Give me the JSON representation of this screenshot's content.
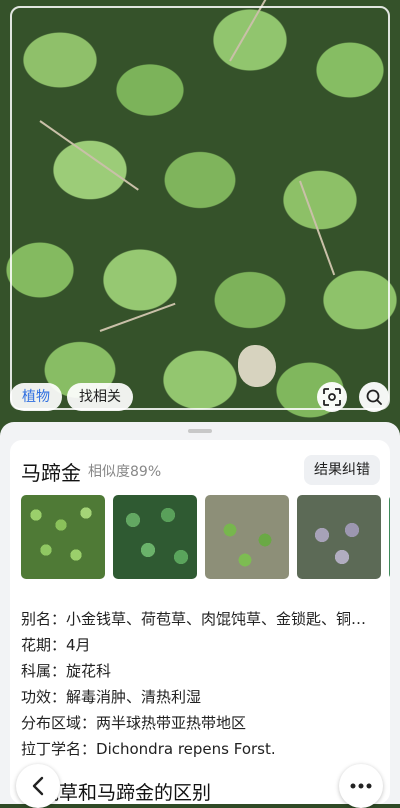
{
  "photo": {
    "chips": [
      {
        "label": "植物",
        "active": true
      },
      {
        "label": "找相关",
        "active": false
      }
    ],
    "icons": [
      "scan-icon",
      "search-icon"
    ]
  },
  "result": {
    "name": "马蹄金",
    "similarity": "相似度89%",
    "correct_button": "结果纠错",
    "thumbnails": 5,
    "info": [
      {
        "key": "别名：",
        "value": "小金钱草、荷苞草、肉馄饨草、金锁匙、铜…"
      },
      {
        "key": "花期：",
        "value": "4月"
      },
      {
        "key": "科属：",
        "value": "旋花科"
      },
      {
        "key": "功效：",
        "value": "解毒消肿、清热利湿"
      },
      {
        "key": "分布区域：",
        "value": "两半球热带亚热带地区"
      },
      {
        "key": "拉丁学名：",
        "value": "Dichondra repens Forst."
      }
    ],
    "section_title": "铜钱草和马蹄金的区别"
  },
  "nav": {
    "back_icon": "chevron-left-icon",
    "more_icon": "more-icon"
  }
}
